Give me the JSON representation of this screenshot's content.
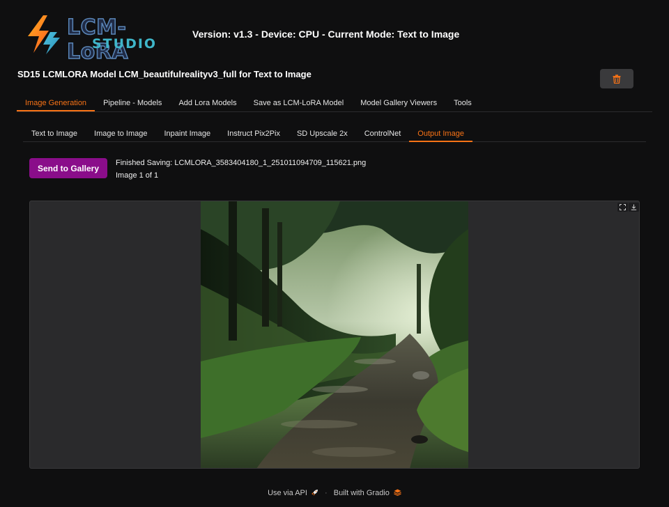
{
  "header": {
    "logo_line1": "LCM-LoRA",
    "logo_line2": "STUDIO",
    "version_text": "Version: v1.3 - Device: CPU - Current Mode: Text to Image",
    "model_title": "SD15 LCMLORA Model LCM_beautifulrealityv3_full for Text to Image"
  },
  "main_tabs": [
    {
      "label": "Image Generation",
      "active": true
    },
    {
      "label": "Pipeline - Models",
      "active": false
    },
    {
      "label": "Add Lora Models",
      "active": false
    },
    {
      "label": "Save as LCM-LoRA Model",
      "active": false
    },
    {
      "label": "Model Gallery Viewers",
      "active": false
    },
    {
      "label": "Tools",
      "active": false
    }
  ],
  "sub_tabs": [
    {
      "label": "Text to Image",
      "active": false
    },
    {
      "label": "Image to Image",
      "active": false
    },
    {
      "label": "Inpaint Image",
      "active": false
    },
    {
      "label": "Instruct Pix2Pix",
      "active": false
    },
    {
      "label": "SD Upscale 2x",
      "active": false
    },
    {
      "label": "ControlNet",
      "active": false
    },
    {
      "label": "Output Image",
      "active": true
    }
  ],
  "output": {
    "send_label": "Send to Gallery",
    "saving_text": "Finished Saving: LCMLORA_3583404180_1_251011094709_115621.png",
    "count_text": "Image 1 of 1"
  },
  "footer": {
    "api_label": "Use via API",
    "gradio_label": "Built with Gradio"
  },
  "colors": {
    "accent": "#f97316",
    "send_button": "#8a0d8a",
    "background": "#0f0f10"
  },
  "icons": {
    "trash": "trash-icon",
    "fullscreen": "fullscreen-icon",
    "download": "download-icon",
    "rocket": "rocket-icon",
    "gradio": "gradio-logo-icon"
  }
}
